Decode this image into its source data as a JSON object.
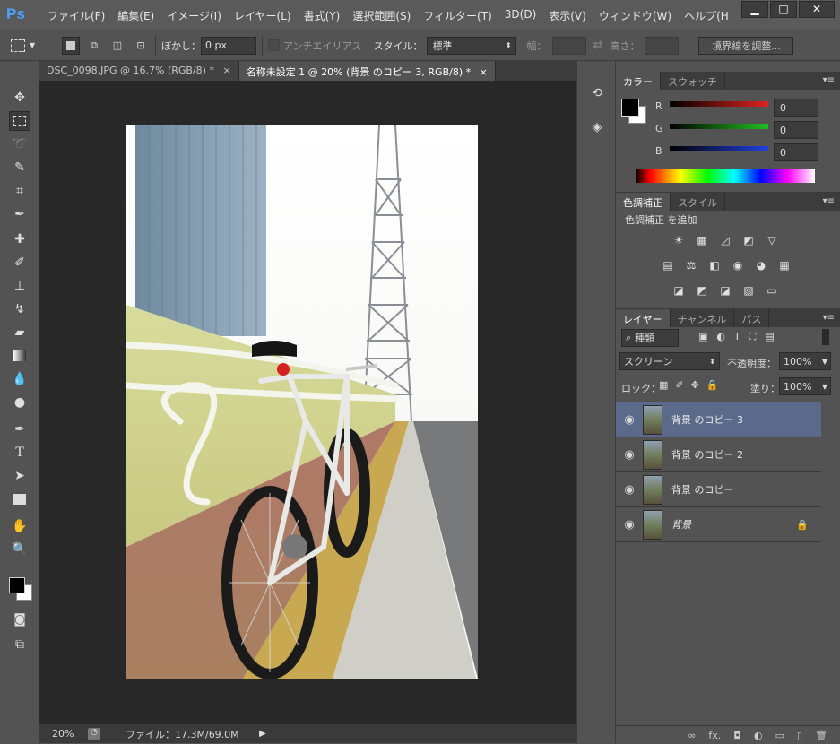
{
  "app": {
    "logo": "Ps"
  },
  "menu": [
    "ファイル(F)",
    "編集(E)",
    "イメージ(I)",
    "レイヤー(L)",
    "書式(Y)",
    "選択範囲(S)",
    "フィルター(T)",
    "3D(D)",
    "表示(V)",
    "ウィンドウ(W)",
    "ヘルプ(H"
  ],
  "window_buttons": {
    "minimize": "▁",
    "maximize": "□",
    "close": "✕"
  },
  "options": {
    "feather_label": "ぼかし：",
    "feather_value": "0 px",
    "antialias_label": "アンチエイリアス",
    "style_label": "スタイル：",
    "style_value": "標準",
    "width_label": "幅：",
    "height_label": "高さ：",
    "refine_button": "境界線を調整..."
  },
  "doc_tabs": [
    {
      "label": "DSC_0098.JPG @ 16.7% (RGB/8) *",
      "close": "×"
    },
    {
      "label": "名称未設定 1 @ 20% (背景 のコピー 3, RGB/8) *",
      "close": "×"
    }
  ],
  "status": {
    "zoom": "20%",
    "file_info": "ファイル：17.3M/69.0M"
  },
  "color_panel": {
    "tabs": [
      "カラー",
      "スウォッチ"
    ],
    "r_label": "R",
    "g_label": "G",
    "b_label": "B",
    "r_value": "0",
    "g_value": "0",
    "b_value": "0",
    "colors": {
      "r": "#e02020",
      "g": "#20c020",
      "b": "#2040e0"
    }
  },
  "adjust_panel": {
    "tabs": [
      "色調補正",
      "スタイル"
    ],
    "title": "色調補正 を追加",
    "row1": [
      "☀",
      "▦",
      "◿",
      "◩",
      "▽"
    ],
    "row2": [
      "▤",
      "⚖",
      "◧",
      "◉",
      "◕",
      "▦"
    ],
    "row3": [
      "◪",
      "◩",
      "◪",
      "▧",
      "▭"
    ]
  },
  "layers_panel": {
    "tabs": [
      "レイヤー",
      "チャンネル",
      "パス"
    ],
    "filter_label": "種類",
    "blend_mode": "スクリーン",
    "opacity_label": "不透明度：",
    "opacity_value": "100%",
    "lock_label": "ロック：",
    "fill_label": "塗り：",
    "fill_value": "100%",
    "layers": [
      {
        "name": "背景 のコピー 3"
      },
      {
        "name": "背景 のコピー 2"
      },
      {
        "name": "背景 のコピー"
      },
      {
        "name": "背景"
      }
    ],
    "bottom_icons": [
      "∞",
      "fx.",
      "◘",
      "◐",
      "▭",
      "▯",
      "🗑"
    ]
  }
}
